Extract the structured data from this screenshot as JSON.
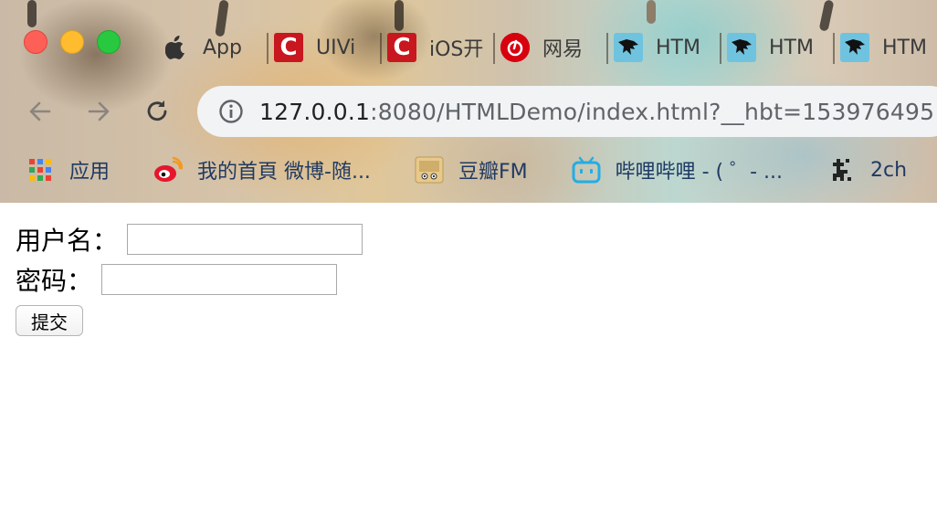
{
  "window": {
    "tabs": [
      {
        "icon": "apple-icon",
        "label": "App"
      },
      {
        "icon": "csdn-icon",
        "label": "UIVi"
      },
      {
        "icon": "csdn-icon",
        "label": "iOS开"
      },
      {
        "icon": "netease-music-icon",
        "label": "网易"
      },
      {
        "icon": "eagle-icon",
        "label": "HTM"
      },
      {
        "icon": "eagle-icon",
        "label": "HTM"
      },
      {
        "icon": "eagle-icon",
        "label": "HTM"
      }
    ]
  },
  "nav": {
    "url_host": "127.0.0.1",
    "url_rest": ":8080/HTMLDemo/index.html?__hbt=153976495"
  },
  "bookmarks": [
    {
      "icon": "apps-grid-icon",
      "label": "应用"
    },
    {
      "icon": "weibo-icon",
      "label": "我的首頁 微博-随..."
    },
    {
      "icon": "douban-fm-icon",
      "label": "豆瓣FM"
    },
    {
      "icon": "bilibili-icon",
      "label": "哔哩哔哩 - ( ゜- ..."
    },
    {
      "icon": "pixel-art-icon",
      "label": "2ch"
    }
  ],
  "form": {
    "username_label": "用户名：",
    "username_value": "",
    "password_label": "密码：",
    "password_value": "",
    "submit_label": "提交"
  },
  "colors": {
    "close": "#fe5f57",
    "minimize": "#febc2e",
    "maximize": "#28c840",
    "url_bar": "#f1f3f4",
    "csdn_red": "#c8171e"
  }
}
